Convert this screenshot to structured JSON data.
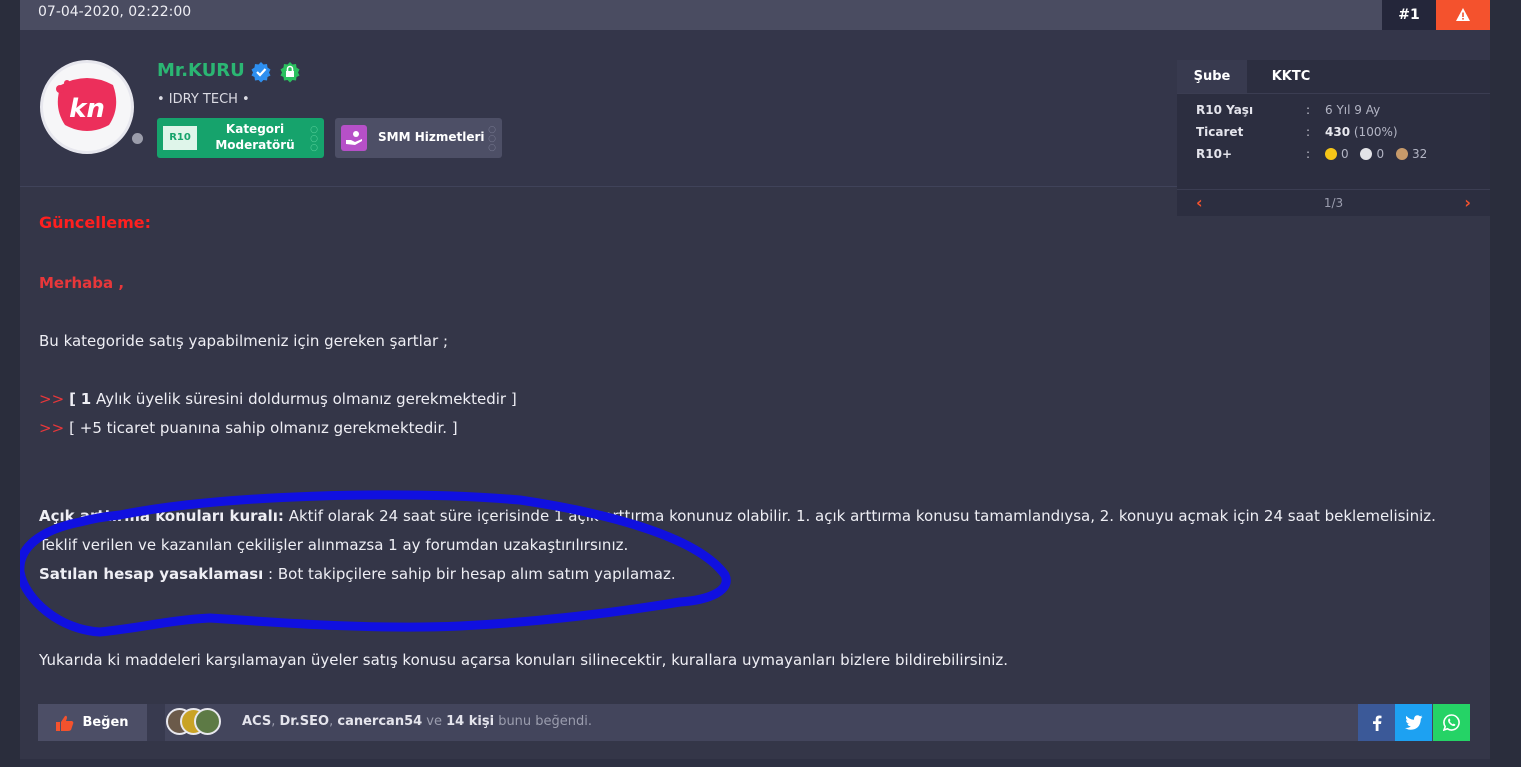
{
  "post": {
    "date": "07-04-2020, 02:22:00",
    "number": "#1"
  },
  "user": {
    "avatar_text": "kn",
    "name": "Mr.KURU",
    "title": "• IDRY TECH •",
    "badges": [
      {
        "tag": "R10",
        "line1": "Kategori",
        "line2": "Moderatörü"
      },
      {
        "label": "SMM Hizmetleri"
      }
    ]
  },
  "info": {
    "tabs": [
      "Şube",
      "KKTC"
    ],
    "rows": [
      {
        "label": "R10 Yaşı",
        "colon": ":",
        "value": "6 Yıl 9 Ay"
      },
      {
        "label": "Ticaret",
        "colon": ":",
        "value_bold": "430",
        "value_rest": " (100%)"
      },
      {
        "label": "R10+",
        "colon": ":",
        "gold": "0",
        "silver": "0",
        "bronze": "32"
      }
    ],
    "pager": {
      "prev": "‹",
      "count": "1/3",
      "next": "›"
    }
  },
  "content": {
    "heading": "Güncelleme:",
    "greeting": "Merhaba ,",
    "intro": "Bu kategoride satış yapabilmeniz için gereken şartlar ;",
    "rules": [
      {
        "arrow": ">>",
        "open": "[",
        "bold": "1",
        "text": " Aylık üyelik süresini doldurmuş olmanız gerekmektedir ]"
      },
      {
        "arrow": ">>",
        "text": "[ +5 ticaret puanına sahip olmanız gerekmektedir. ]"
      }
    ],
    "auction_bold": "Açık arttırma konuları kuralı:",
    "auction_text": " Aktif olarak 24 saat süre içerisinde 1 açık arttırma konunuz olabilir. 1. açık arttırma konusu tamamlandıysa, 2. konuyu açmak için 24 saat beklemelisiniz.",
    "giveaway": "Teklif verilen ve kazanılan çekilişler alınmazsa 1 ay forumdan uzakaştırılırsınız.",
    "account_bold": "Satılan hesap yasaklaması",
    "account_text": " : Bot takipçilere sahip bir hesap alım satım yapılamaz.",
    "closing": "Yukarıda ki maddeleri karşılamayan üyeler satış konusu açarsa konuları silinecektir, kurallara uymayanları bizlere bildirebilirsiniz."
  },
  "likes": {
    "button": "Beğen",
    "names": [
      "ACS",
      "Dr.SEO",
      "canercan54"
    ],
    "sep": ",",
    "and": " ve ",
    "others": "14 kişi",
    "suffix": " bunu beğendi."
  },
  "colors": {
    "accent": "#f4522d",
    "username": "#2bb673",
    "heading": "#ff1f1f",
    "scribble": "#1010e0"
  }
}
